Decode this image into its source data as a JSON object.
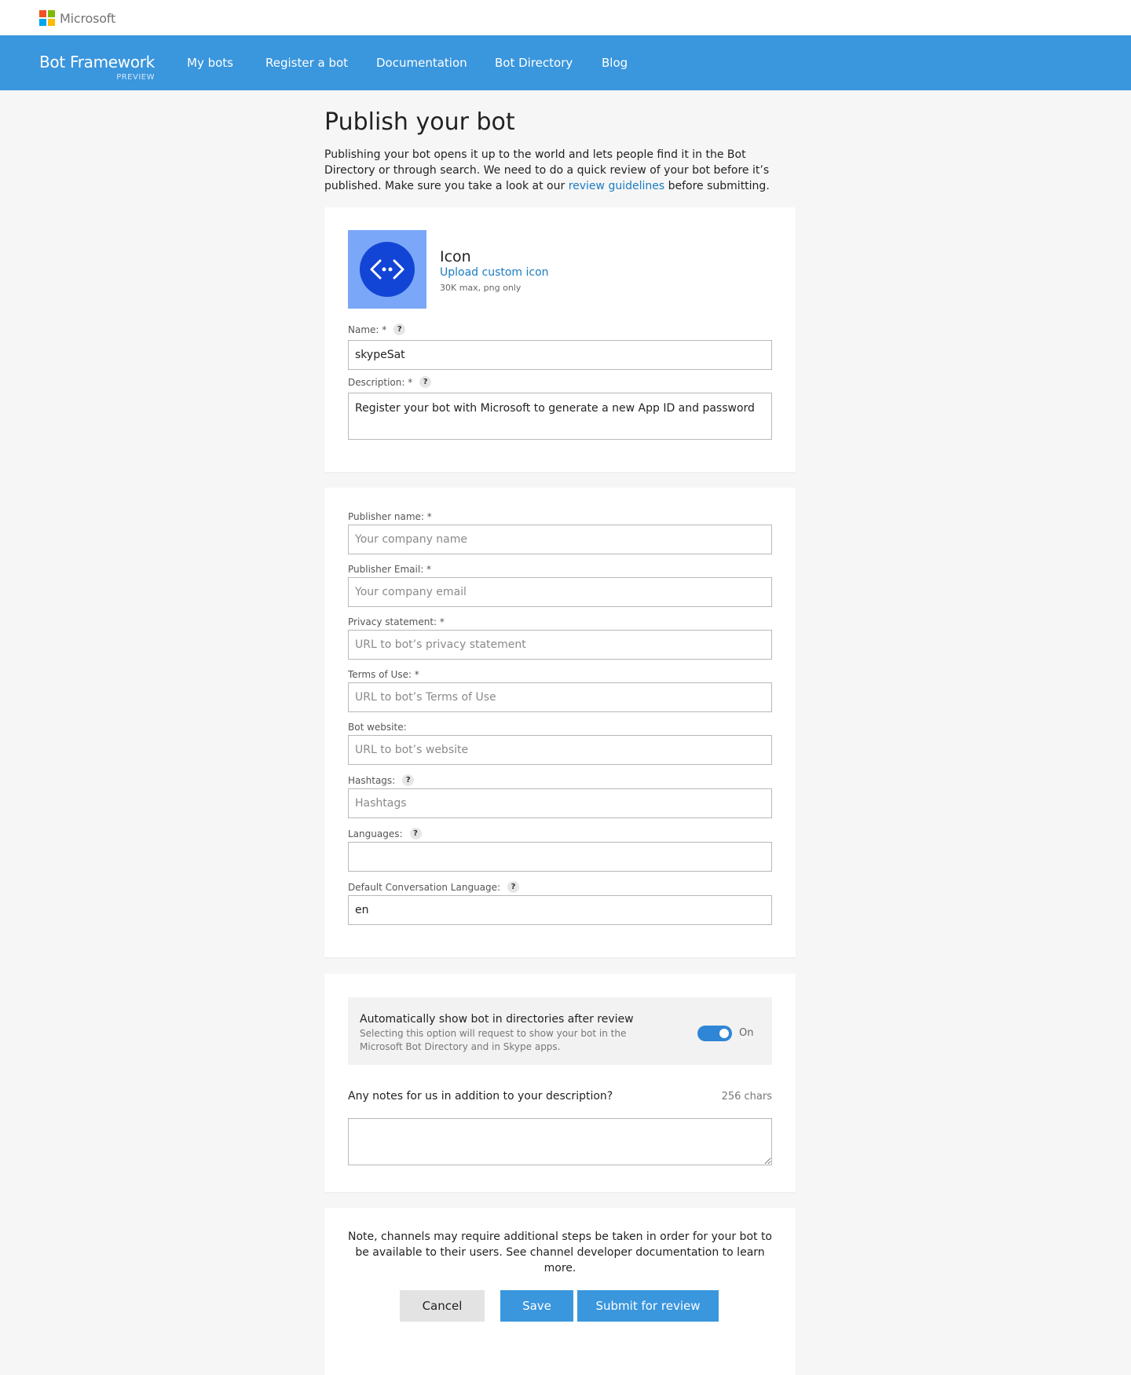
{
  "topbar": {
    "brand": "Microsoft"
  },
  "nav": {
    "brand_title": "Bot Framework",
    "brand_sub": "PREVIEW",
    "links": [
      "My bots",
      "Register a bot",
      "Documentation",
      "Bot Directory",
      "Blog"
    ]
  },
  "page": {
    "title": "Publish your bot",
    "intro_before": "Publishing your bot opens it up to the world and lets people find it in the Bot Directory or through search. We need to do a quick review of your bot before it’s published. Make sure you take a look at our ",
    "intro_link": "review guidelines",
    "intro_after": " before submitting."
  },
  "icon_section": {
    "label": "Icon",
    "upload_link": "Upload custom icon",
    "hint": "30K max, png only"
  },
  "basic": {
    "name_label": "Name: *",
    "name_value": "skypeSat",
    "description_label": "Description: *",
    "description_value": "Register your bot with Microsoft to generate a new App ID and password"
  },
  "publisher": {
    "publisher_name_label": "Publisher name: *",
    "publisher_name_placeholder": "Your company name",
    "publisher_email_label": "Publisher Email: *",
    "publisher_email_placeholder": "Your company email",
    "privacy_label": "Privacy statement: *",
    "privacy_placeholder": "URL to bot’s privacy statement",
    "terms_label": "Terms of Use: *",
    "terms_placeholder": "URL to bot’s Terms of Use",
    "website_label": "Bot website:",
    "website_placeholder": "URL to bot’s website",
    "hashtags_label": "Hashtags:",
    "hashtags_placeholder": "Hashtags",
    "languages_label": "Languages:",
    "languages_value": "",
    "default_lang_label": "Default Conversation Language:",
    "default_lang_value": "en"
  },
  "directory": {
    "toggle_title": "Automatically show bot in directories after review",
    "toggle_desc": "Selecting this option will request to show your bot in the Microsoft Bot Directory and in Skype apps.",
    "toggle_state": "On",
    "toggle_on": true,
    "notes_label": "Any notes for us in addition to your description?",
    "notes_count": "256 chars",
    "notes_value": ""
  },
  "footer": {
    "note": "Note, channels may require additional steps be taken in order for your bot to be available to their users. See channel developer documentation to learn more.",
    "cancel": "Cancel",
    "save": "Save",
    "submit": "Submit for review"
  },
  "colors": {
    "nav_bg": "#3a96dd",
    "link": "#1a7cc4",
    "icon_tile": "#7aa7f7",
    "icon_circle": "#1245d6",
    "ms_red": "#f25022",
    "ms_green": "#7fba00",
    "ms_blue": "#00a4ef",
    "ms_yellow": "#ffb900"
  }
}
